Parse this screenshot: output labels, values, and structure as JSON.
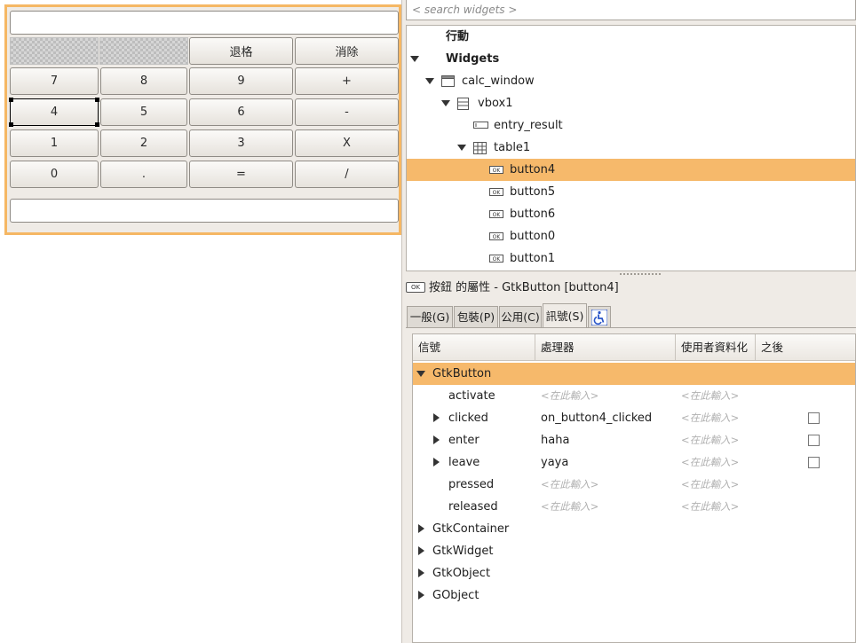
{
  "calculator": {
    "display_value": "",
    "status_value": "",
    "top_buttons": [
      "退格",
      "消除"
    ],
    "rows": [
      [
        "7",
        "8",
        "9",
        "+"
      ],
      [
        "4",
        "5",
        "6",
        "-"
      ],
      [
        "1",
        "2",
        "3",
        "X"
      ],
      [
        "0",
        ".",
        "=",
        "/"
      ]
    ],
    "selected_button": "4"
  },
  "inspector": {
    "search_placeholder": "< search widgets >",
    "tree": {
      "actions": "行動",
      "widgets": "Widgets",
      "calc_window": "calc_window",
      "vbox1": "vbox1",
      "entry_result": "entry_result",
      "table1": "table1",
      "buttons": [
        "button4",
        "button5",
        "button6",
        "button0",
        "button1"
      ]
    },
    "properties_title": "按鈕 的屬性 - GtkButton [button4]",
    "ok_icon_text": "OK",
    "tabs": [
      "一般(G)",
      "包裝(P)",
      "公用(C)",
      "訊號(S)"
    ],
    "signals": {
      "columns": [
        "信號",
        "處理器",
        "使用者資料化",
        "之後"
      ],
      "placeholder": "<在此輸入>",
      "groups": [
        {
          "name": "GtkButton",
          "expanded": true,
          "items": [
            {
              "signal": "activate",
              "handler": "",
              "user_data": "",
              "expandable": false,
              "has_after": false
            },
            {
              "signal": "clicked",
              "handler": "on_button4_clicked",
              "user_data": "",
              "expandable": true,
              "has_after": true
            },
            {
              "signal": "enter",
              "handler": "haha",
              "user_data": "",
              "expandable": true,
              "has_after": true
            },
            {
              "signal": "leave",
              "handler": "yaya",
              "user_data": "",
              "expandable": true,
              "has_after": true
            },
            {
              "signal": "pressed",
              "handler": "",
              "user_data": "",
              "expandable": false,
              "has_after": false
            },
            {
              "signal": "released",
              "handler": "",
              "user_data": "",
              "expandable": false,
              "has_after": false
            }
          ]
        },
        {
          "name": "GtkContainer",
          "expanded": false
        },
        {
          "name": "GtkWidget",
          "expanded": false
        },
        {
          "name": "GtkObject",
          "expanded": false
        },
        {
          "name": "GObject",
          "expanded": false
        }
      ]
    }
  },
  "colors": {
    "selection": "#f6b96b",
    "frame_highlight": "#f5b764",
    "background": "#efebe6"
  }
}
